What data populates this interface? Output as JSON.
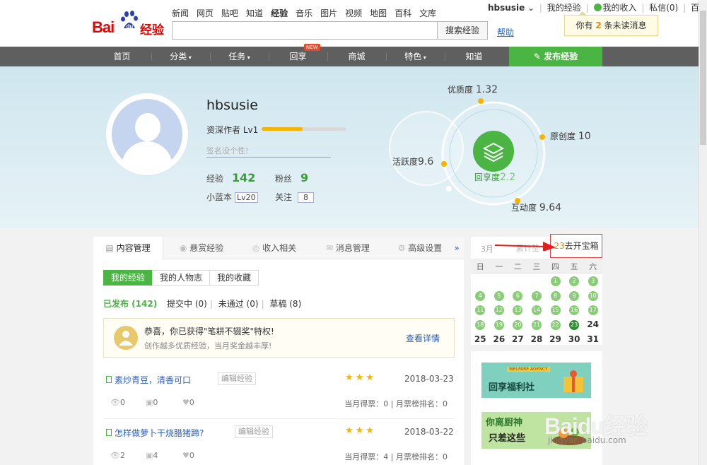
{
  "logo": {
    "text_bai": "Bai",
    "text_jingyan": "经验"
  },
  "topnav": [
    "新闻",
    "网页",
    "贴吧",
    "知道",
    "经验",
    "音乐",
    "图片",
    "视频",
    "地图",
    "百科",
    "文库"
  ],
  "search": {
    "button": "搜索经验",
    "help": "帮助"
  },
  "topbar": {
    "user": "hbsusie",
    "income": "我的收入",
    "messages": "私信(0)",
    "home": "百度首页",
    "notice_pre": "你有",
    "notice_num": "2",
    "notice_post": "条未读消息"
  },
  "mainnav": [
    "首页",
    "分类",
    "任务",
    "回享",
    "商城",
    "特色",
    "知道"
  ],
  "mainnav_new": "NEW",
  "publish": "发布经验",
  "profile": {
    "name": "hbsusie",
    "level_title": "资深作者 Lv1",
    "level_progress": 0.48,
    "signature_placeholder": "签名没个性!",
    "exp_label": "经验",
    "exp_value": "142",
    "fans_label": "粉丝",
    "fans_value": "9",
    "bluebook_label": "小蓝本",
    "bluebook_value": "Lv20",
    "follow_label": "关注",
    "follow_value": "8"
  },
  "radar": {
    "center_label": "回享度",
    "center_value": "2.2",
    "quality_label": "优质度",
    "quality_value": "1.32",
    "original_label": "原创度",
    "original_value": "10",
    "active_label": "活跃度",
    "active_value": "9.6",
    "interact_label": "互动度",
    "interact_value": "9.64"
  },
  "tabs": [
    "内容管理",
    "悬赏经验",
    "收入相关",
    "消息管理",
    "高级设置"
  ],
  "tabs_more": "»",
  "subtabs": [
    "我的经验",
    "我的人物志",
    "我的收藏"
  ],
  "filters": {
    "published": "已发布 (142)",
    "submitting": "提交中 (0)",
    "rejected": "未通过 (0)",
    "draft": "草稿 (8)"
  },
  "congrats": {
    "line1": "恭喜，你已获得\"笔耕不辍奖\"特权!",
    "line2": "创作越多优质经验，当月奖金越丰厚!",
    "detail": "查看详情"
  },
  "articles": [
    {
      "title": "素炒青豆，清香可口",
      "edit": "编辑经验",
      "stars": "★★★",
      "date": "2018-03-23",
      "views": "0",
      "votes": "0",
      "likes": "0",
      "rank": "当月得票：0 | 月票榜排名：0"
    },
    {
      "title": "怎样做萝卜干烧腊猪蹄?",
      "edit": "编辑经验",
      "stars": "★★★",
      "date": "2018-03-22",
      "views": "2",
      "votes": "4",
      "likes": "0",
      "rank": "当月得票：4 | 月票榜排名：0"
    }
  ],
  "calendar": {
    "month": "3月",
    "ghost": "累计签",
    "box_num": "23",
    "box_text": "去开宝箱",
    "weekdays": [
      "日",
      "一",
      "二",
      "三",
      "四",
      "五",
      "六"
    ],
    "rows": [
      [
        "",
        "",
        "",
        "",
        "1",
        "2",
        "3"
      ],
      [
        "4",
        "5",
        "6",
        "7",
        "8",
        "9",
        "10"
      ],
      [
        "11",
        "12",
        "13",
        "14",
        "15",
        "16",
        "17"
      ],
      [
        "18",
        "19",
        "20",
        "21",
        "22",
        "23",
        "24"
      ],
      [
        "25",
        "26",
        "27",
        "28",
        "29",
        "30",
        "31"
      ]
    ],
    "signed_through": 23
  },
  "ads": {
    "ad1_tag": "WELFARE AGENCY",
    "ad1_text": "回享福利社",
    "ad2_line1": "你离厨神",
    "ad2_line2": "只差这些"
  },
  "watermark": {
    "main": "Baidu经验",
    "url": "jingyan.baidu.com"
  },
  "colors": {
    "green": "#4bb543",
    "nav": "#5f5f5f",
    "gold": "#f6b400",
    "link": "#2b5fb4"
  }
}
